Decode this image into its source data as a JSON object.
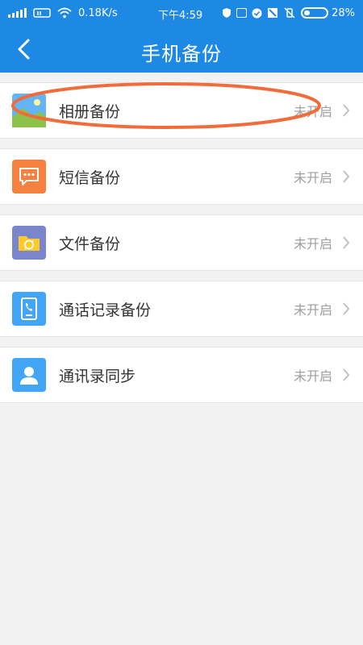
{
  "status_bar": {
    "network_speed": "0.18K/s",
    "time": "下午4:59",
    "battery_percent": "28%",
    "battery_level": 0.28
  },
  "header": {
    "title": "手机备份"
  },
  "backup_items": [
    {
      "label": "相册备份",
      "status": "未开启",
      "icon": "photo-icon",
      "color": "#64b5f6"
    },
    {
      "label": "短信备份",
      "status": "未开启",
      "icon": "message-icon",
      "color": "#f4813f"
    },
    {
      "label": "文件备份",
      "status": "未开启",
      "icon": "folder-icon",
      "color": "#7986cb"
    },
    {
      "label": "通话记录备份",
      "status": "未开启",
      "icon": "call-log-icon",
      "color": "#42a5f5"
    },
    {
      "label": "通讯录同步",
      "status": "未开启",
      "icon": "contacts-icon",
      "color": "#42a5f5"
    }
  ],
  "colors": {
    "header_bg": "#1e88e5",
    "highlight_ellipse": "#f26b3a"
  }
}
